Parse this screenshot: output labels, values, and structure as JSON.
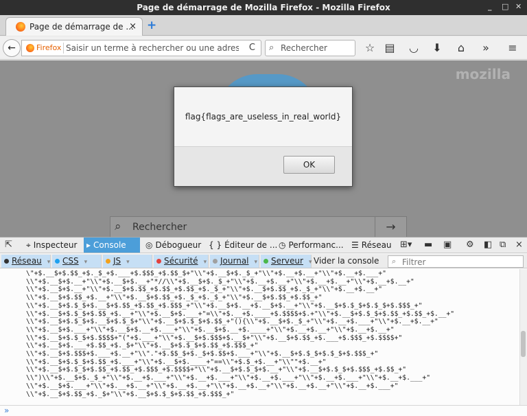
{
  "window": {
    "title": "Page de démarrage de Mozilla Firefox - Mozilla Firefox",
    "controls": [
      "_",
      "□",
      "✕"
    ]
  },
  "tab": {
    "label": "Page de démarrage de ...",
    "close": "×",
    "new": "+"
  },
  "navbar": {
    "back": "←",
    "identity": "Firefox",
    "url_placeholder": "Saisir un terme à rechercher ou une adresse",
    "reload": "C",
    "search_placeholder": "Rechercher",
    "search_icon": "⌕"
  },
  "toolbar_icons": [
    "star-icon",
    "reading-list-icon",
    "pocket-icon",
    "download-icon",
    "home-icon",
    "overflow-icon",
    "menu-icon"
  ],
  "toolbar_glyphs": {
    "star": "☆",
    "readinglist": "▤",
    "pocket": "◡",
    "download": "⬇",
    "home": "⌂",
    "overflow": "»",
    "menu": "≡"
  },
  "content": {
    "brand": "mozilla",
    "search_placeholder": "Rechercher",
    "search_icon": "⌕",
    "go": "→"
  },
  "dialog": {
    "message": "flag{flags_are_useless_in_real_world}",
    "ok": "OK"
  },
  "devtools": {
    "tabs": [
      {
        "glyph": "⌖",
        "label": "Inspecteur"
      },
      {
        "glyph": "▸",
        "label": "Console"
      },
      {
        "glyph": "◎",
        "label": "Débogueur"
      },
      {
        "glyph": "{ }",
        "label": "Éditeur de ..."
      },
      {
        "glyph": "◷",
        "label": "Performanc..."
      },
      {
        "glyph": "☰",
        "label": "Réseau"
      }
    ],
    "filters": [
      {
        "label": "Réseau",
        "color": "#333333"
      },
      {
        "label": "CSS",
        "color": "#1ea1ef"
      },
      {
        "label": "JS",
        "color": "#f4a11a"
      },
      {
        "label": "Sécurité",
        "color": "#e3403c"
      },
      {
        "label": "Journal",
        "color": "#a0a0a0"
      },
      {
        "label": "Serveur",
        "color": "#4ab74a"
      }
    ],
    "clear": "Vider la console",
    "filter_placeholder": "Filtrer",
    "prompt": "»",
    "output_lines": [
      "\\\"+$.__$+$.$$_+$._$_+$.___+$.$$$_+$.$$_$+\"\\\\\"+$.__$+$._$_+\"\\\\\"+$.__+$.__+\"\\\\\"+$.__+$.___+\"",
      "\\\\\"+$.__$+$.__+\"\\\\\"+$.__$+$.__+\"*//\\\\\"+$.__$+$._$_+\"\\\\\"+$.__+$.__+\"\\\\\"+$.__+$.__+\"\\\\\"+$.__+$.__+\"",
      "\\\\\"+$.__$+$.__+\"\\\\\"+$.__$+$.$$_+$.$$_+$.$$_+$._$_+\"\\\\\"+$.__$+$.$$_+$._$_+\"\\\\\"+$.__+$.__+\"",
      "\\\\\"+$.__$+$.$$_+$.__+\"\\\\\"+$.__$+$.$$_+$._$_+$._$_+\"\\\\\"+$.__$+$.$$_+$.$$_+\"",
      "\\\\\"+$.__$+$.$_$+$.__$+$.$$_+$.$$_+$.$$$_+\"\\\\\"+$.__$+$.__+$.__$+$.__+\"\\\\\"+$.__$+$.$_$+$.$_$+$.$$$_+\"",
      "\\\\\"+$.__$+$.$_$+$.$$_+$.__+\"\\\\\"+$.__$+$.___+\"=\\\\\"+$.__+$.____+$.$$$$+$.+\"\\\\\"+$.__$+$.$_$+$.$$_+$.$$_+$.__+\"",
      "\\\\\"+$.__$+$.$_$+$.__$+$.$_$+\"\\\\\"+$.__$+$.$_$+$.$$_+\"(){\\\\\"+$.__$+$._$_+\"\\\\\"+$.__+$.___+\"\\\\\"+$.__+$.__+\"",
      "\\\\\"+$.__$+$.___+\"\\\\\"+$.__$+$.__+$.___+\"\\\\\"+$.__$+$.__+$.____+\"\\\\\"+$.__+$.__+\"\\\\\"+$.__+$.__+\"",
      "\\\\\"+$.__$+$.$_$+$.$$$$+\"(\"+$.___+\"\\\\\"+$.__$+$.$$$+$.__$+\"\\\\\"+$.__$+$.$$_+$.___+$.$$$_+$.$$$$+\"",
      "\\\\\"+$.__$+$.___+$.$$_+$._$+\"\\\\\"+$.__$+$.$_$+$.$$_+$.$$$_+\"",
      "\\\\\"+$.__$+$.$$$+$.___+$.__+\"\\\\\".\"+$.$$_$+$._$+$.$$+$.___+\"\\\\\"+$.__$+$.$_$+$.$_$+$.$$$_+\"",
      "\\\\\"+$.__$+$.$_$+$.$$_+$.___+\"\\\\\"+$.__$+$.____+\"==\\\\\"+$.$_+$.__+\"\\\\\"\"+$.__+\"",
      "\\\\\"+$.__$+$.$_$+$.$$_+$.$$_+$.$$$_+$.$$$$+\"\\\\\"+$.__$+$.$_$+$.__+\"\\\\\"+$.__$+$.$_$+$.$$$_+$.$$_+\"",
      "\\\\\")\\\\\"+$.__$+$._$_+\"\\\\\"+$.__+$.___+\"\\\\\"+$.__+$.___+\"\\\\\"+$.__+$.___+\"\\\\\"+$.__+$.___+\"\\\\\"+$.__+$.___+\"",
      "\\\\\"+$.__$+$.___+\"\\\\\"+$.__+$.__+\"\\\\\"+$.__+$.__+\"\\\\\"+$.__+$.__+\"\\\\\"+$.__+$.__+\"\\\\\"+$.__+$.___+\"",
      "\\\\\"+$.__$+$.$$_+$._$+\"\\\\\"+$.__$+$.$_$+$.$$_+$.$$$_+\""
    ]
  }
}
